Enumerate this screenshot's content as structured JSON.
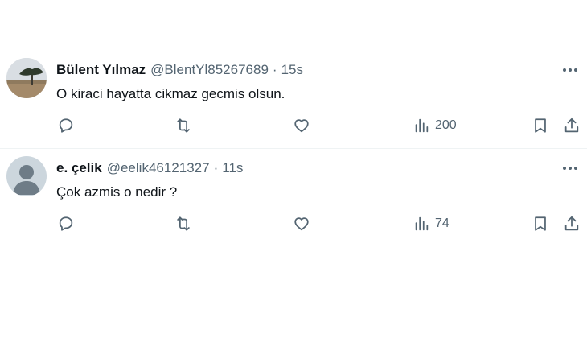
{
  "tweets": [
    {
      "name": "Bülent Yılmaz",
      "handle": "@BlentYl85267689",
      "separator": "·",
      "time": "15s",
      "text": "O kiraci hayatta cikmaz gecmis olsun.",
      "views": "200",
      "avatar": "landscape-tree-photo"
    },
    {
      "name": "e. çelik",
      "handle": "@eelik46121327",
      "separator": "·",
      "time": "11s",
      "text": "Çok azmis o nedir ?",
      "views": "74",
      "avatar": "default-avatar"
    }
  ],
  "icons": [
    "more-icon",
    "reply-icon",
    "retweet-icon",
    "like-icon",
    "views-icon",
    "bookmark-icon",
    "share-icon"
  ],
  "colors": {
    "text": "#0f1419",
    "secondary": "#536471",
    "divider": "#eff3f4"
  }
}
